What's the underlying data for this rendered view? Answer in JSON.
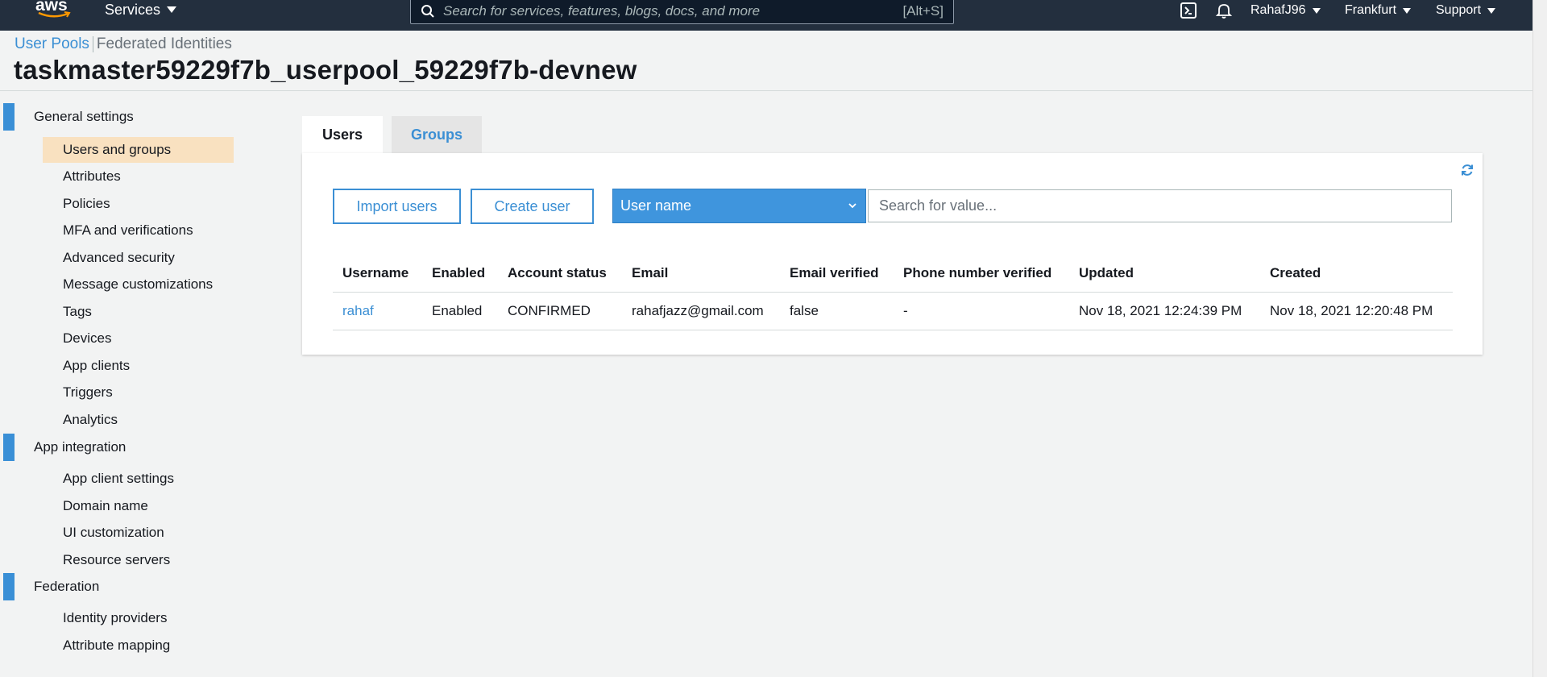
{
  "topnav": {
    "logo_text": "aws",
    "services_label": "Services",
    "search_placeholder": "Search for services, features, blogs, docs, and more",
    "search_shortcut": "[Alt+S]",
    "user_label": "RahafJ96",
    "region_label": "Frankfurt",
    "support_label": "Support",
    "icons": [
      "cloudshell-icon",
      "bell-icon"
    ]
  },
  "header": {
    "breadcrumbs": [
      "User Pools",
      "Federated Identities"
    ],
    "title": "taskmaster59229f7b_userpool_59229f7b-devnew"
  },
  "sidebar": {
    "sections": [
      {
        "label": "General settings",
        "items": [
          "Users and groups",
          "Attributes",
          "Policies",
          "MFA and verifications",
          "Advanced security",
          "Message customizations",
          "Tags",
          "Devices",
          "App clients",
          "Triggers",
          "Analytics"
        ]
      },
      {
        "label": "App integration",
        "items": [
          "App client settings",
          "Domain name",
          "UI customization",
          "Resource servers"
        ]
      },
      {
        "label": "Federation",
        "items": [
          "Identity providers",
          "Attribute mapping"
        ]
      }
    ],
    "active_item": "Users and groups"
  },
  "tabs": {
    "users": "Users",
    "groups": "Groups",
    "active": "Users"
  },
  "toolbar": {
    "import_label": "Import users",
    "create_label": "Create user",
    "filter_selected": "User name",
    "search_placeholder": "Search for value..."
  },
  "table": {
    "columns": [
      "Username",
      "Enabled",
      "Account status",
      "Email",
      "Email verified",
      "Phone number verified",
      "Updated",
      "Created"
    ],
    "rows": [
      [
        "rahaf",
        "Enabled",
        "CONFIRMED",
        "rahafjazz@gmail.com",
        "false",
        "-",
        "Nov 18, 2021 12:24:39 PM",
        "Nov 18, 2021 12:20:48 PM"
      ]
    ]
  },
  "colors": {
    "nav_bg": "#232f3e",
    "accent_blue": "#3b8fd4",
    "active_item_bg": "#f9e1c0"
  }
}
